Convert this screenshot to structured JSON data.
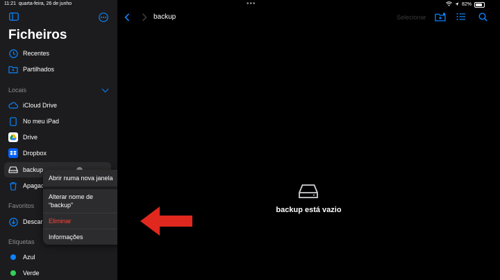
{
  "status": {
    "time": "11:21",
    "date": "quarta-feira, 26 de junho",
    "battery": "82%"
  },
  "sidebar": {
    "title": "Ficheiros",
    "items_top": [
      {
        "label": "Recentes",
        "icon": "clock-icon"
      },
      {
        "label": "Partilhados",
        "icon": "shared-folder-icon"
      }
    ],
    "locations_label": "Locais",
    "locations": [
      {
        "label": "iCloud Drive",
        "icon": "cloud-icon"
      },
      {
        "label": "No meu iPad",
        "icon": "ipad-icon"
      },
      {
        "label": "Drive",
        "icon": "google-drive-icon"
      },
      {
        "label": "Dropbox",
        "icon": "dropbox-icon"
      },
      {
        "label": "backup",
        "icon": "drive-icon"
      },
      {
        "label": "Apagado",
        "icon": "trash-icon"
      }
    ],
    "favorites_label": "Favoritos",
    "favorites": [
      {
        "label": "Descarregamentos",
        "icon": "download-icon"
      }
    ],
    "tags_label": "Etiquetas",
    "tags": [
      {
        "label": "Azul",
        "color": "#0a84ff"
      },
      {
        "label": "Verde",
        "color": "#30d158"
      }
    ]
  },
  "context_menu": {
    "items": [
      {
        "label": "Abrir numa nova janela",
        "icon": "new-window-icon"
      },
      {
        "label_line1": "Alterar nome de",
        "label_line2": "“backup”",
        "icon": "pencil-icon"
      },
      {
        "label": "Eliminar",
        "icon": "eject-icon",
        "color": "#ff453a"
      },
      {
        "label": "Informações",
        "icon": "info-icon"
      }
    ]
  },
  "toolbar": {
    "folder_title": "backup",
    "select_label": "Selecionar"
  },
  "main": {
    "empty_message": "backup está vazio"
  },
  "colors": {
    "accent": "#0a84ff",
    "destructive": "#ff453a",
    "annotation_arrow": "#e0281e"
  }
}
